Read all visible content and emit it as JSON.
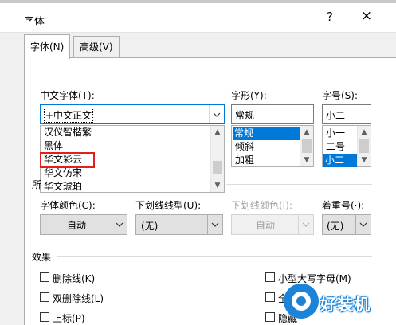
{
  "dialog": {
    "title": "字体",
    "help": "?",
    "close": "×"
  },
  "tabs": [
    {
      "label": "字体(N)"
    },
    {
      "label": "高级(V)"
    }
  ],
  "chinese_font": {
    "label": "中文字体(T):",
    "value": "+中文正文",
    "list": [
      "汉仪智楷繁",
      "黑体",
      "华文彩云",
      "华文仿宋",
      "华文琥珀"
    ],
    "highlighted": "华文彩云"
  },
  "font_style": {
    "label": "字形(Y):",
    "value": "常规",
    "list": [
      "常规",
      "倾斜",
      "加粗"
    ],
    "selected": "常规"
  },
  "font_size": {
    "label": "字号(S):",
    "value": "小二",
    "list": [
      "小一",
      "二号",
      "小二"
    ],
    "selected": "小二"
  },
  "partial_group_label": "所",
  "font_color": {
    "label": "字体颜色(C):",
    "value": "自动"
  },
  "underline_style": {
    "label": "下划线线型(U):",
    "value": "(无)"
  },
  "underline_color": {
    "label": "下划线颜色(I):",
    "value": "自动"
  },
  "emphasis": {
    "label": "着重号(·):",
    "value": "(无)"
  },
  "effects": {
    "label": "效果",
    "left": [
      "删除线(K)",
      "双删除线(L)",
      "上标(P)"
    ],
    "right": [
      "小型大写字母(M)",
      "全",
      "隐藏"
    ]
  },
  "watermark": {
    "text": "好装机"
  }
}
